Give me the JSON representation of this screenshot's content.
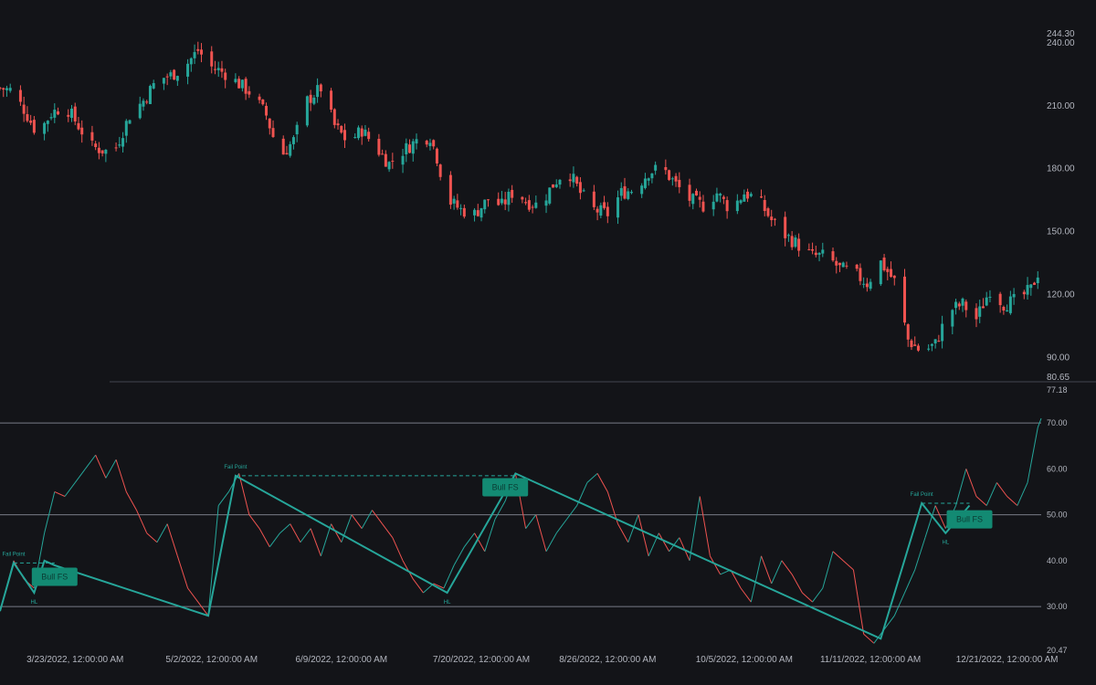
{
  "colors": {
    "background": "#131418",
    "up": "#26a69a",
    "down": "#ef5350",
    "axis_text": "#b2b5be",
    "separator": "#434651",
    "level_line": "#787b86",
    "badge": "#138a73",
    "badge_text": "#0b3b33"
  },
  "chart_data": [
    {
      "type": "candlestick",
      "pane": "price",
      "ylim": [
        80.65,
        244.3
      ],
      "y_ticks": [
        "244.30",
        "240.00",
        "210.00",
        "180.00",
        "150.00",
        "120.00",
        "90.00",
        "80.65"
      ],
      "x_start": "2022-03-01",
      "x_end": "2022-12-31",
      "x_ticks": [
        "3/23/2022, 12:00:00 AM",
        "5/2/2022, 12:00:00 AM",
        "6/9/2022, 12:00:00 AM",
        "7/20/2022, 12:00:00 AM",
        "8/26/2022, 12:00:00 AM",
        "10/5/2022, 12:00:00 AM",
        "11/11/2022, 12:00:00 AM",
        "12/21/2022, 12:00:00 AM"
      ],
      "close_path": [
        [
          "2022-03-01",
          218
        ],
        [
          "2022-03-04",
          217
        ],
        [
          "2022-03-08",
          208
        ],
        [
          "2022-03-12",
          196
        ],
        [
          "2022-03-16",
          206
        ],
        [
          "2022-03-20",
          210
        ],
        [
          "2022-03-24",
          200
        ],
        [
          "2022-03-28",
          190
        ],
        [
          "2022-04-01",
          188
        ],
        [
          "2022-04-04",
          190
        ],
        [
          "2022-04-08",
          205
        ],
        [
          "2022-04-12",
          212
        ],
        [
          "2022-04-16",
          222
        ],
        [
          "2022-04-20",
          224
        ],
        [
          "2022-04-24",
          228
        ],
        [
          "2022-04-28",
          236
        ],
        [
          "2022-05-02",
          228
        ],
        [
          "2022-05-06",
          225
        ],
        [
          "2022-05-10",
          220
        ],
        [
          "2022-05-14",
          215
        ],
        [
          "2022-05-18",
          205
        ],
        [
          "2022-05-22",
          185
        ],
        [
          "2022-05-26",
          193
        ],
        [
          "2022-05-30",
          212
        ],
        [
          "2022-06-03",
          218
        ],
        [
          "2022-06-07",
          200
        ],
        [
          "2022-06-11",
          192
        ],
        [
          "2022-06-15",
          198
        ],
        [
          "2022-06-19",
          190
        ],
        [
          "2022-06-23",
          182
        ],
        [
          "2022-06-27",
          188
        ],
        [
          "2022-07-01",
          193
        ],
        [
          "2022-07-05",
          195
        ],
        [
          "2022-07-07",
          185
        ],
        [
          "2022-07-10",
          165
        ],
        [
          "2022-07-14",
          160
        ],
        [
          "2022-07-18",
          158
        ],
        [
          "2022-07-22",
          165
        ],
        [
          "2022-07-26",
          162
        ],
        [
          "2022-07-30",
          170
        ],
        [
          "2022-08-02",
          164
        ],
        [
          "2022-08-06",
          162
        ],
        [
          "2022-08-10",
          172
        ],
        [
          "2022-08-14",
          180
        ],
        [
          "2022-08-18",
          168
        ],
        [
          "2022-08-22",
          160
        ],
        [
          "2022-08-26",
          158
        ],
        [
          "2022-08-30",
          168
        ],
        [
          "2022-09-03",
          170
        ],
        [
          "2022-09-07",
          178
        ],
        [
          "2022-09-11",
          180
        ],
        [
          "2022-09-15",
          172
        ],
        [
          "2022-09-19",
          165
        ],
        [
          "2022-09-23",
          162
        ],
        [
          "2022-09-27",
          168
        ],
        [
          "2022-10-01",
          160
        ],
        [
          "2022-10-05",
          168
        ],
        [
          "2022-10-09",
          165
        ],
        [
          "2022-10-13",
          155
        ],
        [
          "2022-10-17",
          148
        ],
        [
          "2022-10-21",
          143
        ],
        [
          "2022-10-25",
          138
        ],
        [
          "2022-10-29",
          138
        ],
        [
          "2022-11-02",
          132
        ],
        [
          "2022-11-06",
          130
        ],
        [
          "2022-11-10",
          125
        ],
        [
          "2022-11-14",
          135
        ],
        [
          "2022-11-18",
          126
        ],
        [
          "2022-11-22",
          98
        ],
        [
          "2022-11-26",
          92
        ],
        [
          "2022-11-30",
          96
        ],
        [
          "2022-12-04",
          112
        ],
        [
          "2022-12-08",
          115
        ],
        [
          "2022-12-12",
          108
        ],
        [
          "2022-12-16",
          122
        ],
        [
          "2022-12-20",
          115
        ],
        [
          "2022-12-24",
          117
        ],
        [
          "2022-12-28",
          122
        ],
        [
          "2022-12-31",
          134
        ]
      ]
    },
    {
      "type": "line",
      "pane": "oscillator",
      "ylim": [
        20.47,
        77.18
      ],
      "y_ticks": [
        "77.18",
        "70.00",
        "60.00",
        "50.00",
        "40.00",
        "30.00",
        "20.47"
      ],
      "levels": [
        70,
        50,
        30
      ],
      "series": [
        {
          "points": [
            [
              "2022-03-01",
              29
            ],
            [
              "2022-03-05",
              40
            ],
            [
              "2022-03-08",
              36
            ],
            [
              "2022-03-11",
              34
            ],
            [
              "2022-03-14",
              46
            ],
            [
              "2022-03-17",
              55
            ],
            [
              "2022-03-20",
              54
            ],
            [
              "2022-03-23",
              57
            ],
            [
              "2022-03-26",
              60
            ],
            [
              "2022-03-29",
              63
            ],
            [
              "2022-04-01",
              58
            ],
            [
              "2022-04-04",
              62
            ],
            [
              "2022-04-07",
              55
            ],
            [
              "2022-04-10",
              51
            ],
            [
              "2022-04-13",
              46
            ],
            [
              "2022-04-16",
              44
            ],
            [
              "2022-04-19",
              48
            ],
            [
              "2022-04-22",
              41
            ],
            [
              "2022-04-25",
              34
            ],
            [
              "2022-04-28",
              31
            ],
            [
              "2022-05-01",
              28
            ],
            [
              "2022-05-04",
              52
            ],
            [
              "2022-05-07",
              55
            ],
            [
              "2022-05-10",
              59
            ],
            [
              "2022-05-13",
              50
            ],
            [
              "2022-05-16",
              47
            ],
            [
              "2022-05-19",
              43
            ],
            [
              "2022-05-22",
              46
            ],
            [
              "2022-05-25",
              48
            ],
            [
              "2022-05-28",
              44
            ],
            [
              "2022-05-31",
              47
            ],
            [
              "2022-06-03",
              41
            ],
            [
              "2022-06-06",
              48
            ],
            [
              "2022-06-09",
              44
            ],
            [
              "2022-06-12",
              50
            ],
            [
              "2022-06-15",
              47
            ],
            [
              "2022-06-18",
              51
            ],
            [
              "2022-06-21",
              48
            ],
            [
              "2022-06-24",
              45
            ],
            [
              "2022-06-27",
              40
            ],
            [
              "2022-06-30",
              36
            ],
            [
              "2022-07-03",
              33
            ],
            [
              "2022-07-06",
              35
            ],
            [
              "2022-07-09",
              34
            ],
            [
              "2022-07-12",
              39
            ],
            [
              "2022-07-15",
              43
            ],
            [
              "2022-07-18",
              46
            ],
            [
              "2022-07-21",
              42
            ],
            [
              "2022-07-24",
              49
            ],
            [
              "2022-07-27",
              53
            ],
            [
              "2022-07-30",
              59
            ],
            [
              "2022-08-02",
              47
            ],
            [
              "2022-08-05",
              50
            ],
            [
              "2022-08-08",
              42
            ],
            [
              "2022-08-11",
              46
            ],
            [
              "2022-08-14",
              49
            ],
            [
              "2022-08-17",
              52
            ],
            [
              "2022-08-20",
              57
            ],
            [
              "2022-08-23",
              59
            ],
            [
              "2022-08-26",
              55
            ],
            [
              "2022-08-29",
              48
            ],
            [
              "2022-09-01",
              44
            ],
            [
              "2022-09-04",
              50
            ],
            [
              "2022-09-07",
              41
            ],
            [
              "2022-09-10",
              46
            ],
            [
              "2022-09-13",
              42
            ],
            [
              "2022-09-16",
              45
            ],
            [
              "2022-09-19",
              40
            ],
            [
              "2022-09-22",
              54
            ],
            [
              "2022-09-25",
              41
            ],
            [
              "2022-09-28",
              37
            ],
            [
              "2022-10-01",
              38
            ],
            [
              "2022-10-04",
              34
            ],
            [
              "2022-10-07",
              31
            ],
            [
              "2022-10-10",
              41
            ],
            [
              "2022-10-13",
              35
            ],
            [
              "2022-10-16",
              40
            ],
            [
              "2022-10-19",
              37
            ],
            [
              "2022-10-22",
              33
            ],
            [
              "2022-10-25",
              31
            ],
            [
              "2022-10-28",
              34
            ],
            [
              "2022-10-31",
              42
            ],
            [
              "2022-11-03",
              40
            ],
            [
              "2022-11-06",
              38
            ],
            [
              "2022-11-09",
              24
            ],
            [
              "2022-11-12",
              22
            ],
            [
              "2022-11-15",
              25
            ],
            [
              "2022-11-18",
              28
            ],
            [
              "2022-11-21",
              33
            ],
            [
              "2022-11-24",
              38
            ],
            [
              "2022-11-27",
              45
            ],
            [
              "2022-11-30",
              52
            ],
            [
              "2022-12-03",
              47
            ],
            [
              "2022-12-06",
              52
            ],
            [
              "2022-12-09",
              60
            ],
            [
              "2022-12-12",
              54
            ],
            [
              "2022-12-15",
              52
            ],
            [
              "2022-12-18",
              57
            ],
            [
              "2022-12-21",
              54
            ],
            [
              "2022-12-24",
              52
            ],
            [
              "2022-12-27",
              57
            ],
            [
              "2022-12-30",
              69
            ],
            [
              "2022-12-31",
              71
            ]
          ]
        }
      ],
      "zigzag": [
        [
          "2022-03-01",
          29
        ],
        [
          "2022-03-05",
          39.5
        ],
        [
          "2022-03-11",
          33
        ],
        [
          "2022-03-14",
          40
        ],
        [
          "2022-03-17",
          39
        ],
        [
          "2022-05-01",
          28
        ],
        [
          "2022-05-09",
          58.5
        ],
        [
          "2022-07-10",
          33
        ],
        [
          "2022-07-30",
          59
        ],
        [
          "2022-11-14",
          23
        ],
        [
          "2022-11-26",
          52.5
        ],
        [
          "2022-12-03",
          46
        ],
        [
          "2022-12-10",
          52
        ]
      ],
      "annotations": [
        {
          "text": "Fail Point",
          "date": "2022-03-05",
          "value": 39.5,
          "pos": "above",
          "color": "#26a69a"
        },
        {
          "text": "HL",
          "date": "2022-03-11",
          "value": 33,
          "pos": "below",
          "color": "#26a69a"
        },
        {
          "text": "Fail Point",
          "date": "2022-05-09",
          "value": 58.5,
          "pos": "above",
          "color": "#26a69a"
        },
        {
          "text": "HL",
          "date": "2022-07-10",
          "value": 33,
          "pos": "below",
          "color": "#26a69a"
        },
        {
          "text": "Fail Point",
          "date": "2022-11-26",
          "value": 52.5,
          "pos": "above",
          "color": "#26a69a"
        },
        {
          "text": "HL",
          "date": "2022-12-03",
          "value": 46,
          "pos": "below",
          "color": "#26a69a"
        }
      ],
      "dashed_levels": [
        {
          "from": "2022-03-05",
          "to": "2022-03-17",
          "value": 39.5
        },
        {
          "from": "2022-05-09",
          "to": "2022-07-30",
          "value": 58.5
        },
        {
          "from": "2022-11-26",
          "to": "2022-12-10",
          "value": 52.5
        }
      ],
      "badges": [
        {
          "text": "Bull FS",
          "date": "2022-03-17",
          "value": 36.5
        },
        {
          "text": "Bull FS",
          "date": "2022-07-27",
          "value": 56
        },
        {
          "text": "Bull FS",
          "date": "2022-12-10",
          "value": 49
        }
      ]
    }
  ]
}
